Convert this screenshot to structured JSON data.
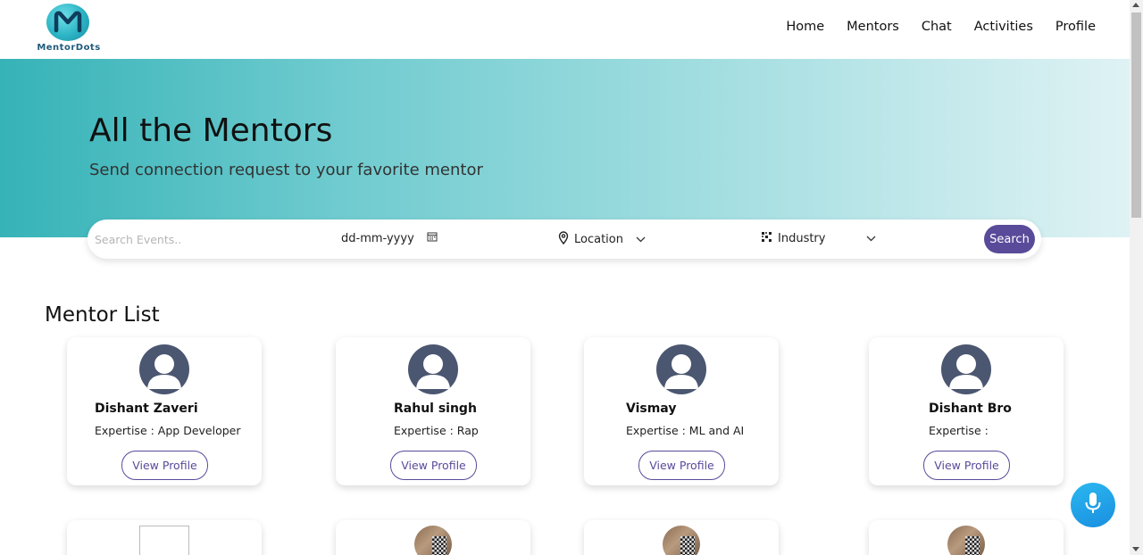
{
  "brand": {
    "name": "MentorDots",
    "icon": "mentordots-logo-icon"
  },
  "nav": [
    {
      "label": "Home"
    },
    {
      "label": "Mentors"
    },
    {
      "label": "Chat"
    },
    {
      "label": "Activities"
    },
    {
      "label": "Profile"
    }
  ],
  "hero": {
    "title": "All the Mentors",
    "subtitle": "Send connection request to your favorite mentor"
  },
  "search": {
    "placeholder": "Search Events..",
    "date_placeholder": "dd-mm-yyyy",
    "location_label": "Location",
    "industry_label": "Industry",
    "button_label": "Search"
  },
  "mentor_list": {
    "title": "Mentor List",
    "mentors": [
      {
        "name": "Dishant Zaveri",
        "expertise": "Expertise : App Developer",
        "button": "View Profile"
      },
      {
        "name": "Rahul singh",
        "expertise": "Expertise : Rap",
        "button": "View Profile"
      },
      {
        "name": "Vismay",
        "expertise": "Expertise : ML and AI",
        "button": "View Profile"
      },
      {
        "name": "Dishant Bro",
        "expertise": "Expertise :",
        "button": "View Profile"
      }
    ]
  },
  "colors": {
    "accent": "#5a4a9a",
    "hero_start": "#36b3b7",
    "hero_end": "#dff2f4",
    "mic": "#1a8ee0",
    "avatar": "#4b5670"
  }
}
